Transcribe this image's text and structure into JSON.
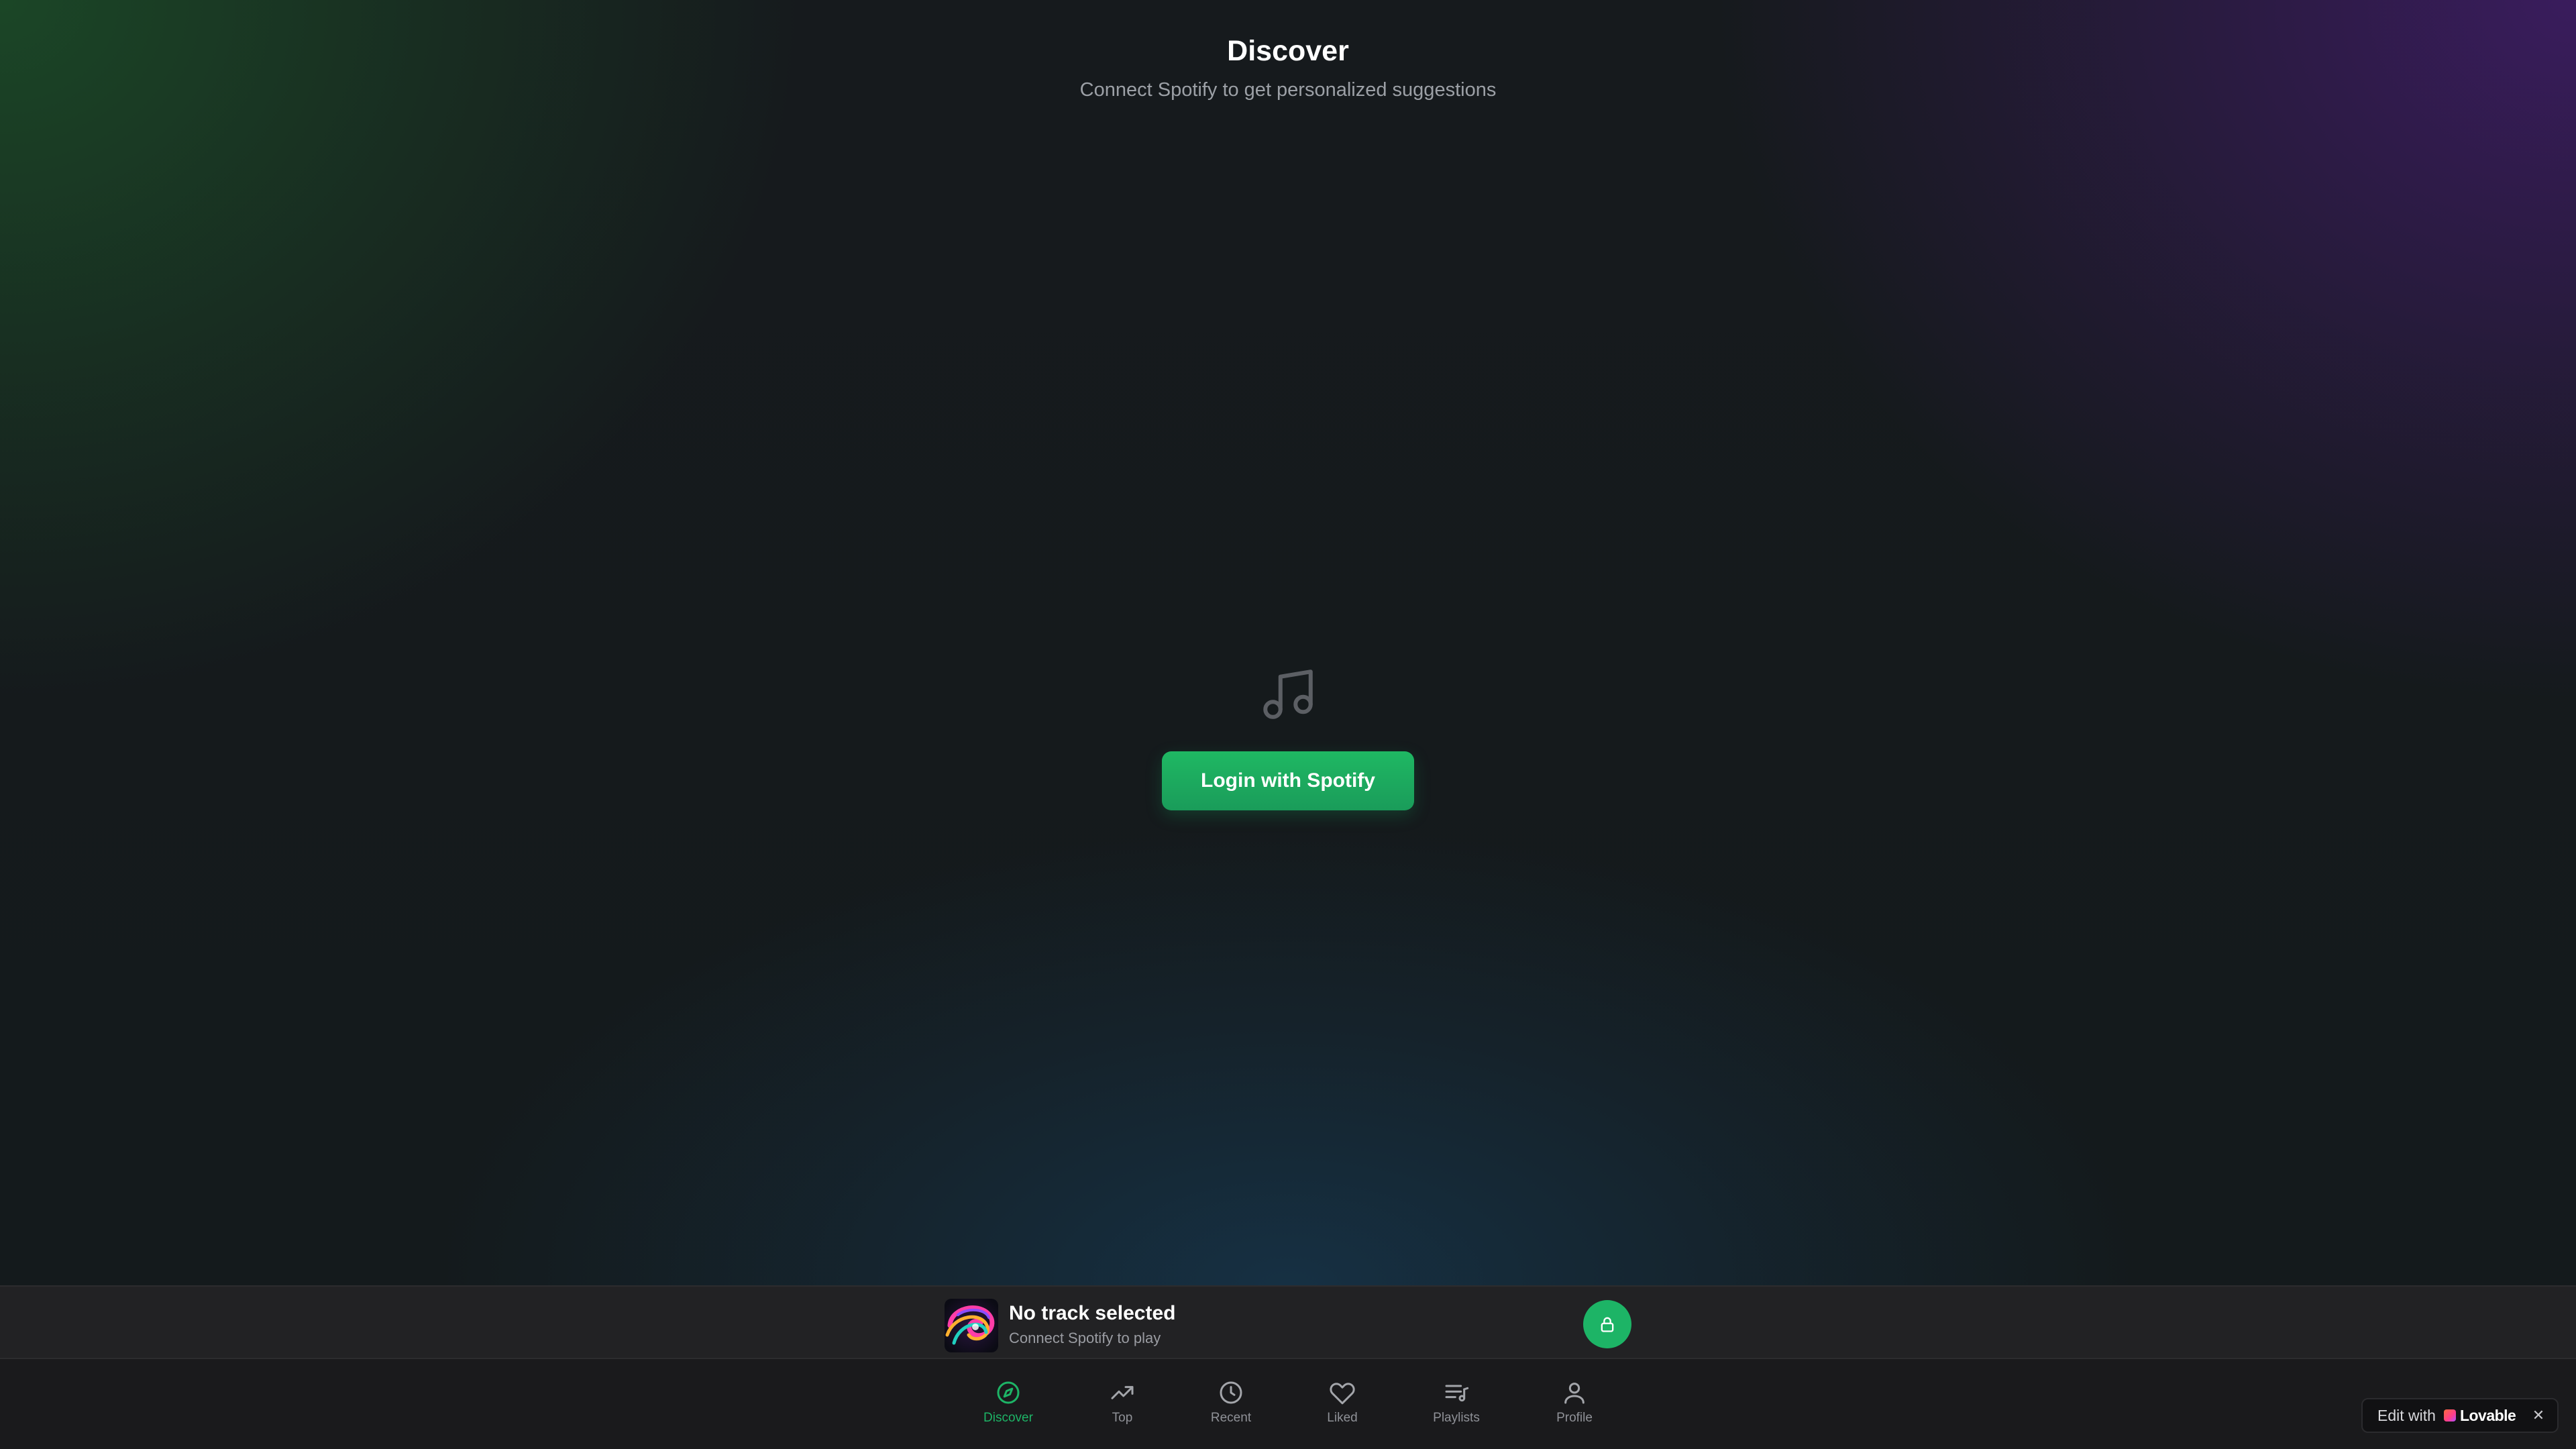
{
  "header": {
    "title": "Discover",
    "subtitle": "Connect Spotify to get personalized suggestions"
  },
  "empty_state": {
    "icon": "music-note-icon",
    "login_button_label": "Login with Spotify"
  },
  "player": {
    "track_title": "No track selected",
    "track_subtitle": "Connect Spotify to play",
    "action_icon": "lock-icon"
  },
  "nav": {
    "items": [
      {
        "label": "Discover",
        "icon": "compass-icon",
        "active": true
      },
      {
        "label": "Top",
        "icon": "trending-up-icon",
        "active": false
      },
      {
        "label": "Recent",
        "icon": "clock-icon",
        "active": false
      },
      {
        "label": "Liked",
        "icon": "heart-icon",
        "active": false
      },
      {
        "label": "Playlists",
        "icon": "playlist-icon",
        "active": false
      },
      {
        "label": "Profile",
        "icon": "user-icon",
        "active": false
      }
    ]
  },
  "badge": {
    "text": "Edit with",
    "brand": "Lovable"
  },
  "colors": {
    "accent": "#1db466",
    "text_primary": "#ffffff",
    "text_muted": "#8f9197"
  }
}
